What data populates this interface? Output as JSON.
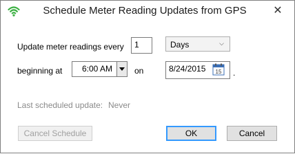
{
  "window": {
    "title": "Schedule Meter Reading Updates from GPS",
    "close_label": "✕"
  },
  "schedule": {
    "update_label": "Update meter readings every",
    "interval_value": "1",
    "interval_unit": "Days",
    "beginning_label": "beginning at",
    "time_value": "6:00 AM",
    "on_label": "on",
    "date_value": "8/24/2015",
    "calendar_day": "15",
    "trailing_period": "."
  },
  "status": {
    "last_update_label": "Last scheduled update:",
    "last_update_value": "Never"
  },
  "buttons": {
    "cancel_schedule": "Cancel Schedule",
    "ok": "OK",
    "cancel": "Cancel"
  },
  "colors": {
    "wifi_icon": "#3cb043",
    "calendar_accent": "#3b6fb6",
    "default_button_border": "#3399ff"
  }
}
